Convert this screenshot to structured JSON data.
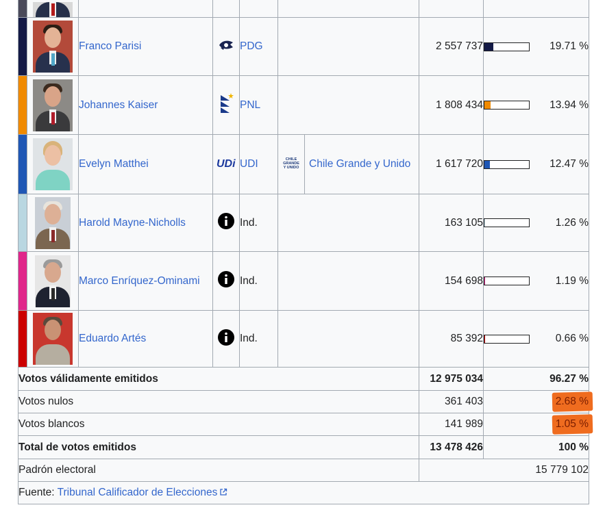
{
  "candidates": [
    {
      "name": "",
      "party": "",
      "coalition": "",
      "votes": "",
      "percent": "",
      "pct_value": 0,
      "color": "#4a4a5a"
    },
    {
      "name": "Franco Parisi",
      "party_logo": "pdg-logo",
      "party": "PDG",
      "coalition": "",
      "votes": "2 557 737",
      "percent": "19.71 %",
      "pct_value": 19.71,
      "color": "#141a46"
    },
    {
      "name": "Johannes Kaiser",
      "party_logo": "pnl-logo",
      "party": "PNL",
      "coalition": "",
      "votes": "1 808 434",
      "percent": "13.94 %",
      "pct_value": 13.94,
      "color": "#f08a00"
    },
    {
      "name": "Evelyn Matthei",
      "party_logo": "udi-logo",
      "party": "UDI",
      "coalition_logo": "chile-grande-y-unido-logo",
      "coalition": "Chile Grande y Unido",
      "votes": "1 617 720",
      "percent": "12.47 %",
      "pct_value": 12.47,
      "color": "#1f57b5"
    },
    {
      "name": "Harold Mayne-Nicholls",
      "party_logo": "info-icon",
      "party": "Ind.",
      "coalition": "",
      "votes": "163 105",
      "percent": "1.26 %",
      "pct_value": 1.26,
      "color": "#b9d7e1"
    },
    {
      "name": "Marco Enríquez-Ominami",
      "party_logo": "info-icon",
      "party": "Ind.",
      "coalition": "",
      "votes": "154 698",
      "percent": "1.19 %",
      "pct_value": 1.19,
      "color": "#e0278a"
    },
    {
      "name": "Eduardo Artés",
      "party_logo": "info-icon",
      "party": "Ind.",
      "coalition": "",
      "votes": "85 392",
      "percent": "0.66 %",
      "pct_value": 0.66,
      "color": "#cc0000"
    }
  ],
  "summary": {
    "valid": {
      "label": "Votos válidamente emitidos",
      "votes": "12 975 034",
      "percent": "96.27 %"
    },
    "null": {
      "label": "Votos nulos",
      "votes": "361 403",
      "percent": "2.68 %"
    },
    "blank": {
      "label": "Votos blancos",
      "votes": "141 989",
      "percent": "1.05 %"
    },
    "total": {
      "label": "Total de votos emitidos",
      "votes": "13 478 426",
      "percent": "100 %"
    },
    "registry": {
      "label": "Padrón electoral",
      "votes": "15 779 102"
    }
  },
  "source": {
    "label": "Fuente:",
    "link": "Tribunal Calificador de Elecciones",
    "icon": "external-link-icon"
  },
  "colors": {
    "link": "#3366cc",
    "highlight": "#ef6c1f",
    "border": "#a2a9b1",
    "cell_bg": "#f8f9fa",
    "empty_bg": "#eaecf0"
  },
  "coalition_logo_text": [
    "CHILE",
    "GRANDE",
    "Y UNIDO"
  ],
  "udi_logo_text": "UDi"
}
